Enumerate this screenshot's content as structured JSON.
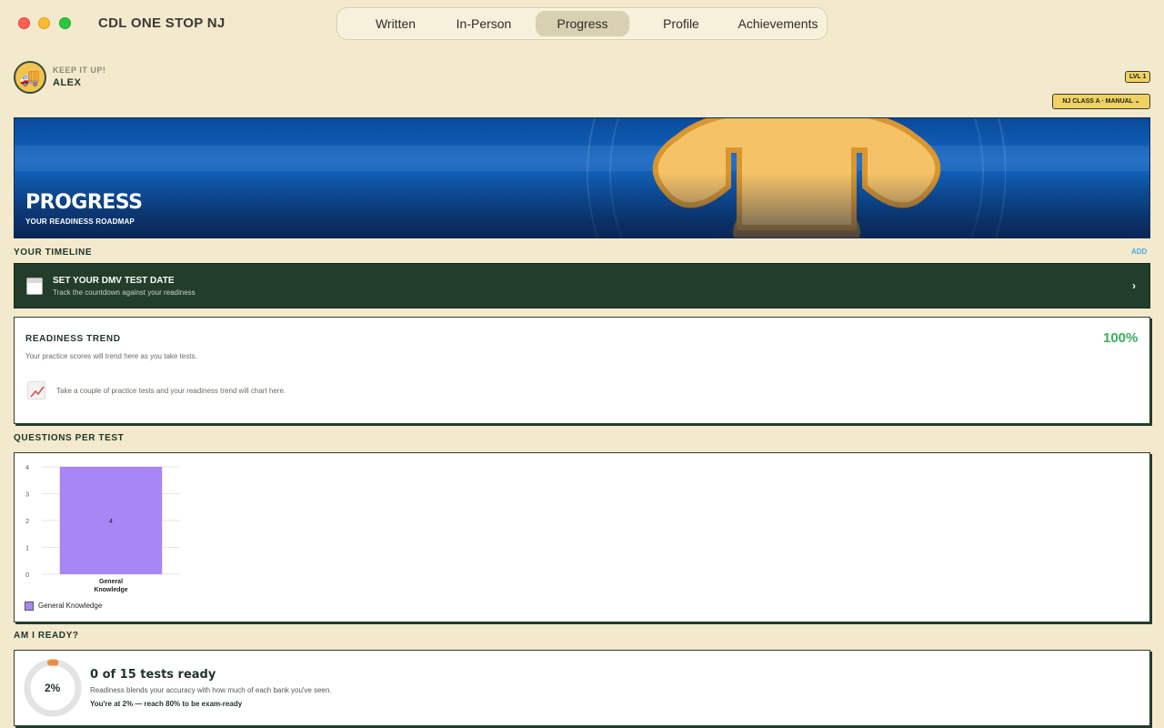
{
  "app": {
    "title": "CDL ONE STOP NJ",
    "tabs": [
      {
        "label": "Written",
        "active": false
      },
      {
        "label": "In-Person",
        "active": false
      },
      {
        "label": "Progress",
        "active": true
      },
      {
        "label": "Profile",
        "active": false
      },
      {
        "label": "Achievements",
        "active": false
      }
    ]
  },
  "user": {
    "greeting": "KEEP IT UP!",
    "name": "ALEX",
    "level": "LVL 1",
    "license": "NJ CLASS A · MANUAL",
    "avatar_icon": "truck-icon"
  },
  "hero": {
    "title": "PROGRESS",
    "subtitle": "YOUR READINESS ROADMAP"
  },
  "timeline": {
    "section_label": "YOUR TIMELINE",
    "add_label": "ADD",
    "title": "SET YOUR DMV TEST DATE",
    "subtitle": "Track the countdown against your readiness",
    "chevron": "›",
    "icon": "calendar-icon"
  },
  "trend": {
    "title": "READINESS TREND",
    "percent": "100%",
    "subtitle": "Your practice scores will trend here as you take tests.",
    "empty_message": "Take a couple of practice tests and your readiness trend will chart here.",
    "icon": "chart-icon"
  },
  "questions_per_test": {
    "section_label": "QUESTIONS PER TEST"
  },
  "chart_data": {
    "type": "bar",
    "categories": [
      "General Knowledge"
    ],
    "series": [
      {
        "name": "General Knowledge",
        "values": [
          4
        ],
        "color": "#a886f5"
      }
    ],
    "ylim": [
      0,
      4
    ],
    "yticks": [
      0,
      1,
      2,
      3,
      4
    ],
    "data_labels": [
      "4"
    ],
    "legend": "bottom-left"
  },
  "readiness": {
    "section_label": "AM I READY?",
    "percent_label": "2%",
    "percent_value": 2,
    "title": "0 of 15 tests ready",
    "description": "Readiness blends your accuracy with how much of each bank you've seen.",
    "note": "You're at 2% — reach 80% to be exam-ready",
    "ring_color": "#f08a45"
  }
}
